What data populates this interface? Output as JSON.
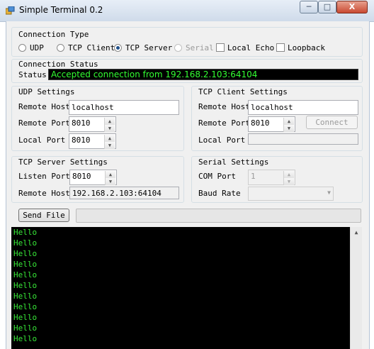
{
  "window": {
    "title": "Simple Terminal 0.2",
    "minimize": "─",
    "maximize": "□",
    "close": "X"
  },
  "connection_type": {
    "heading": "Connection Type",
    "options": [
      {
        "label": "UDP",
        "selected": false
      },
      {
        "label": "TCP Client",
        "selected": false
      },
      {
        "label": "TCP Server",
        "selected": true
      },
      {
        "label": "Serial",
        "selected": false,
        "disabled": true
      }
    ],
    "checkboxes": [
      {
        "label": "Local Echo",
        "checked": false
      },
      {
        "label": "Loopback",
        "checked": false
      }
    ]
  },
  "connection_status": {
    "heading": "Connection Status",
    "label": "Status",
    "value": "Accepted connection from 192.168.2.103:64104",
    "value_color": "#33ff33"
  },
  "udp_settings": {
    "heading": "UDP Settings",
    "remote_host_label": "Remote Host",
    "remote_host_value": "localhost",
    "remote_port_label": "Remote Port",
    "remote_port_value": "8010",
    "local_port_label": "Local Port",
    "local_port_value": "8010"
  },
  "tcp_client_settings": {
    "heading": "TCP Client Settings",
    "remote_host_label": "Remote Host",
    "remote_host_value": "localhost",
    "remote_port_label": "Remote Port",
    "remote_port_value": "8010",
    "connect_label": "Connect",
    "local_port_label": "Local Port",
    "local_port_value": ""
  },
  "tcp_server_settings": {
    "heading": "TCP Server Settings",
    "listen_port_label": "Listen Port",
    "listen_port_value": "8010",
    "remote_host_label": "Remote Host",
    "remote_host_value": "192.168.2.103:64104"
  },
  "serial_settings": {
    "heading": "Serial Settings",
    "com_port_label": "COM Port",
    "com_port_value": "1",
    "baud_rate_label": "Baud Rate",
    "baud_rate_value": ""
  },
  "send_file": {
    "label": "Send File",
    "progress": 0
  },
  "terminal": {
    "text_color": "#37e637",
    "lines": [
      "Hello",
      "Hello",
      "Hello",
      "Hello",
      "Hello",
      "Hello",
      "Hello",
      "Hello",
      "Hello",
      "Hello",
      "Hello"
    ],
    "scroll_up": "▲"
  },
  "colors": {
    "terminal_bg": "#000000",
    "status_bg": "#000000"
  }
}
